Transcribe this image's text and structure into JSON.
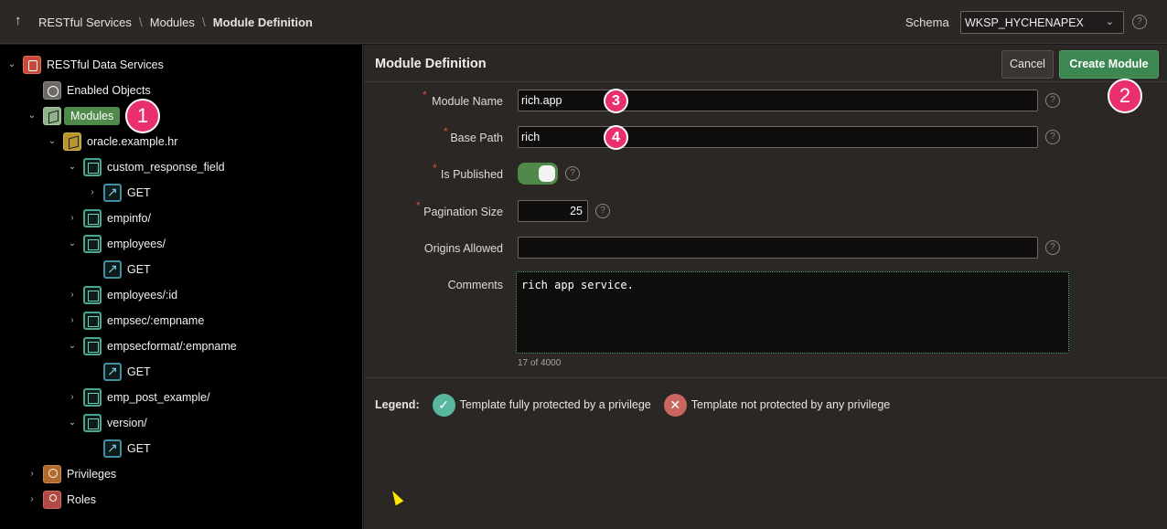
{
  "breadcrumb": {
    "up_icon": "arrow-up-icon",
    "items": [
      "RESTful Services",
      "Modules",
      "Module Definition"
    ]
  },
  "schema": {
    "label": "Schema",
    "value": "WKSP_HYCHENAPEX",
    "help": "?"
  },
  "tree": {
    "root": "RESTful Data Services",
    "enabled_objects": "Enabled Objects",
    "modules": "Modules",
    "module": "oracle.example.hr",
    "templates": [
      {
        "label": "custom_response_field",
        "handler": "GET"
      },
      {
        "label": "empinfo/"
      },
      {
        "label": "employees/",
        "handler": "GET"
      },
      {
        "label": "employees/:id"
      },
      {
        "label": "empsec/:empname"
      },
      {
        "label": "empsecformat/:empname",
        "handler": "GET"
      },
      {
        "label": "emp_post_example/"
      },
      {
        "label": "version/",
        "handler": "GET"
      }
    ],
    "privileges": "Privileges",
    "roles": "Roles"
  },
  "panel": {
    "title": "Module Definition",
    "cancel_label": "Cancel",
    "create_label": "Create Module"
  },
  "form": {
    "module_name_label": "Module Name",
    "module_name_value": "rich.app",
    "base_path_label": "Base Path",
    "base_path_value": "rich",
    "is_published_label": "Is Published",
    "is_published_value": true,
    "pagination_label": "Pagination Size",
    "pagination_value": "25",
    "origins_label": "Origins Allowed",
    "origins_value": "",
    "comments_label": "Comments",
    "comments_value": "rich app service.",
    "comments_counter": "17 of 4000",
    "required_mark": "*",
    "help": "?"
  },
  "legend": {
    "title": "Legend:",
    "protected": "Template fully protected by a privilege",
    "unprotected": "Template not protected by any privilege",
    "check": "✓",
    "cross": "✕"
  },
  "annotations": {
    "one": "1",
    "two": "2",
    "three": "3",
    "four": "4"
  },
  "colors": {
    "accent_green": "#3d8753",
    "badge_pink": "#e9306c",
    "legend_ok": "#58b89f",
    "legend_no": "#c9665f"
  }
}
